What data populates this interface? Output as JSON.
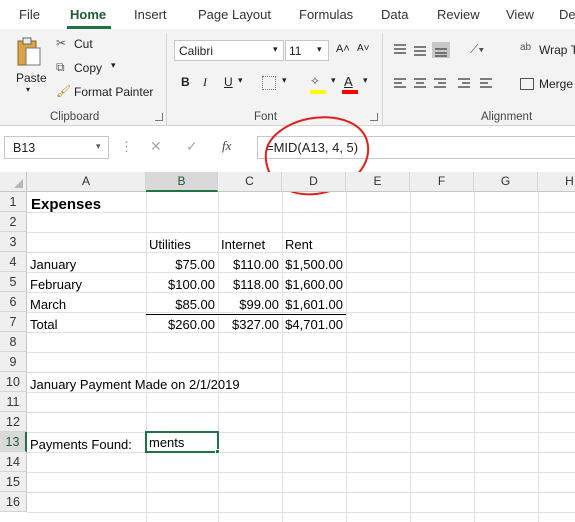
{
  "tabs": [
    "File",
    "Home",
    "Insert",
    "Page Layout",
    "Formulas",
    "Data",
    "Review",
    "View",
    "De"
  ],
  "clipboard": {
    "paste": "Paste",
    "cut": "Cut",
    "copy": "Copy",
    "format_painter": "Format Painter",
    "label": "Clipboard"
  },
  "font": {
    "name": "Calibri",
    "size": "11",
    "bold": "B",
    "italic": "I",
    "underline": "U",
    "grow": "A˄",
    "shrink": "A˅",
    "label": "Font"
  },
  "alignment": {
    "wrap_text": "Wrap T",
    "merge": "Merge",
    "label": "Alignment"
  },
  "formula_bar": {
    "name_box": "B13",
    "fx": "fx",
    "formula": "=MID(A13, 4, 5)"
  },
  "columns": [
    "A",
    "B",
    "C",
    "D",
    "E",
    "F",
    "G",
    "H"
  ],
  "rows": [
    "1",
    "2",
    "3",
    "4",
    "5",
    "6",
    "7",
    "8",
    "9",
    "10",
    "11",
    "12",
    "13",
    "14",
    "15",
    "16"
  ],
  "selected_cell": "B13",
  "cells": {
    "title": "Expenses",
    "headers": [
      "Utilities",
      "Internet",
      "Rent"
    ],
    "data_rows": [
      {
        "label": "January",
        "values": [
          "$75.00",
          "$110.00",
          "$1,500.00"
        ]
      },
      {
        "label": "February",
        "values": [
          "$100.00",
          "$118.00",
          "$1,600.00"
        ]
      },
      {
        "label": "March",
        "values": [
          "$85.00",
          "$99.00",
          "$1,601.00"
        ]
      },
      {
        "label": "Total",
        "values": [
          "$260.00",
          "$327.00",
          "$4,701.00"
        ]
      }
    ],
    "a10": "January Payment Made on 2/1/2019",
    "a13": "Payments Found:",
    "b13": "ments"
  },
  "colors": {
    "accent": "#217346",
    "annotation": "#e0201b",
    "font_highlight": "#ffff00",
    "font_color": "#ff0000"
  }
}
